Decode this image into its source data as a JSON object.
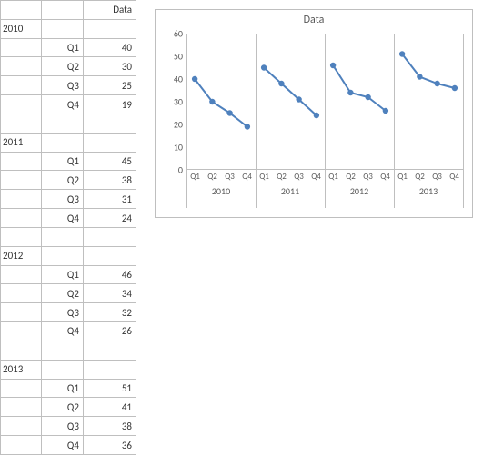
{
  "table": {
    "header": "Data",
    "years": [
      {
        "year": "2010",
        "rows": [
          [
            "Q1",
            "40"
          ],
          [
            "Q2",
            "30"
          ],
          [
            "Q3",
            "25"
          ],
          [
            "Q4",
            "19"
          ]
        ]
      },
      {
        "year": "2011",
        "rows": [
          [
            "Q1",
            "45"
          ],
          [
            "Q2",
            "38"
          ],
          [
            "Q3",
            "31"
          ],
          [
            "Q4",
            "24"
          ]
        ]
      },
      {
        "year": "2012",
        "rows": [
          [
            "Q1",
            "46"
          ],
          [
            "Q2",
            "34"
          ],
          [
            "Q3",
            "32"
          ],
          [
            "Q4",
            "26"
          ]
        ]
      },
      {
        "year": "2013",
        "rows": [
          [
            "Q1",
            "51"
          ],
          [
            "Q2",
            "41"
          ],
          [
            "Q3",
            "38"
          ],
          [
            "Q4",
            "36"
          ]
        ]
      }
    ]
  },
  "chart_data": {
    "type": "line",
    "title": "Data",
    "ylabel": "",
    "xlabel": "",
    "ylim": [
      0,
      60
    ],
    "yticks": [
      0,
      10,
      20,
      30,
      40,
      50,
      60
    ],
    "groups": [
      "2010",
      "2011",
      "2012",
      "2013"
    ],
    "categories": [
      "Q1",
      "Q2",
      "Q3",
      "Q4"
    ],
    "series": [
      {
        "name": "Data",
        "color": "#4f81bd",
        "groups": [
          {
            "group": "2010",
            "values": [
              40,
              30,
              25,
              19
            ]
          },
          {
            "group": "2011",
            "values": [
              45,
              38,
              31,
              24
            ]
          },
          {
            "group": "2012",
            "values": [
              46,
              34,
              32,
              26
            ]
          },
          {
            "group": "2013",
            "values": [
              51,
              41,
              38,
              36
            ]
          }
        ]
      }
    ]
  }
}
